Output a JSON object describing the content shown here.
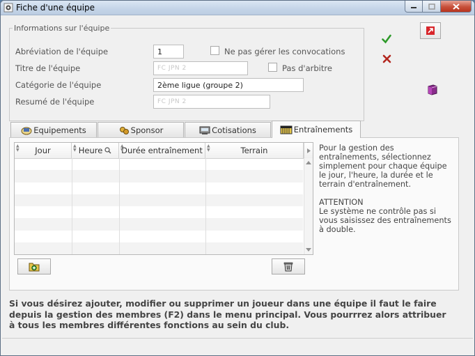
{
  "window": {
    "title": "Fiche d'une équipe"
  },
  "info": {
    "legend": "Informations sur l'équipe",
    "fields": {
      "abbreviation": {
        "label": "Abréviation de l'équipe",
        "value": "1"
      },
      "title": {
        "label": "Titre de l'équipe",
        "value": "FC JPN 2"
      },
      "category": {
        "label": "Catégorie de l'équipe",
        "value": "2ème ligue (groupe 2)"
      },
      "summary": {
        "label": "Resumé de l'équipe",
        "value": "FC JPN 2"
      }
    },
    "checkboxes": {
      "no_convocations": {
        "label": "Ne pas gérer les convocations",
        "checked": false
      },
      "no_referee": {
        "label": "Pas d'arbitre",
        "checked": false
      }
    }
  },
  "tabs": [
    {
      "label": "Equipements",
      "icon": "equipment-icon",
      "active": false
    },
    {
      "label": "Sponsor",
      "icon": "sponsor-icon",
      "active": false
    },
    {
      "label": "Cotisations",
      "icon": "register-icon",
      "active": false
    },
    {
      "label": "Entraînements",
      "icon": "training-icon",
      "active": true
    }
  ],
  "grid": {
    "columns": [
      "Jour",
      "Heure",
      "Durée entraînement",
      "Terrain"
    ],
    "rows": []
  },
  "help": {
    "paragraph1": "Pour la gestion des entraînements, sélectionnez simplement pour chaque équipe le jour, l'heure, la durée et le terrain d'entraînement.",
    "paragraph2_title": "ATTENTION",
    "paragraph2": "Le système ne contrôle pas si vous saisissez des entraînements à double."
  },
  "note": "Si vous désirez ajouter, modifier ou supprimer un joueur dans une équipe il faut le faire depuis la gestion des membres (F2) dans le menu principal. Vous pourrrez alors attribuer à tous les membres différentes fonctions au sein du club.",
  "colors": {
    "accent_green": "#2e9a2a",
    "accent_red": "#b3261e",
    "titlebar": "#c4d4e8"
  }
}
